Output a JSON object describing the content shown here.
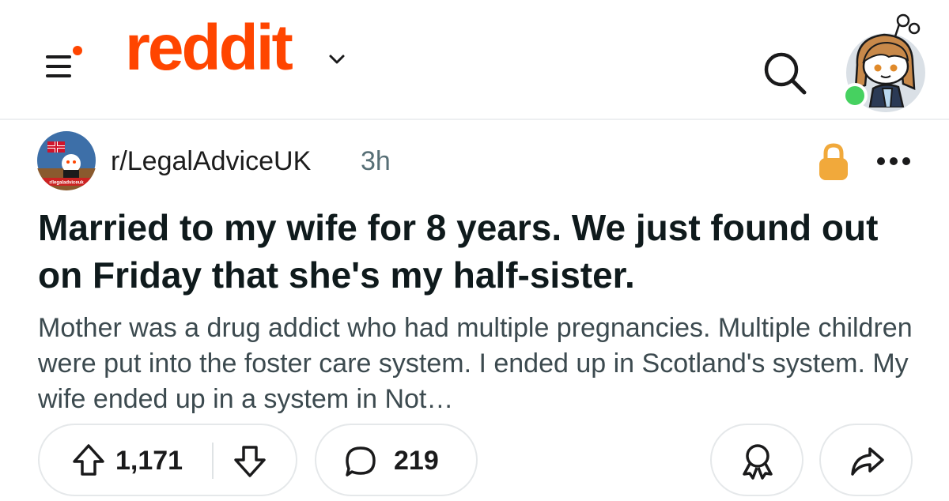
{
  "header": {
    "logo_text": "reddit",
    "menu_icon": "hamburger-menu-icon",
    "chevron_icon": "chevron-down-icon",
    "search_icon": "search-icon",
    "avatar_online": true
  },
  "post": {
    "subreddit": "r/LegalAdviceUK",
    "subreddit_icon_caption": "r/legaladviceuk",
    "time": "3h",
    "locked": true,
    "title": "Married to my wife for 8 years. We just found out on Friday that she's my half-sister.",
    "snippet": "Mother was a drug addict who had multiple pregnancies. Multiple children were put into the foster care system. I ended up in Scotland's system. My wife ended up in a system in Not…",
    "upvotes": "1,171",
    "comments": "219"
  },
  "colors": {
    "brand": "#ff4500",
    "lock": "#f1a93b",
    "online": "#46d160",
    "text": "#1a1a1b",
    "muted": "#576f76"
  }
}
